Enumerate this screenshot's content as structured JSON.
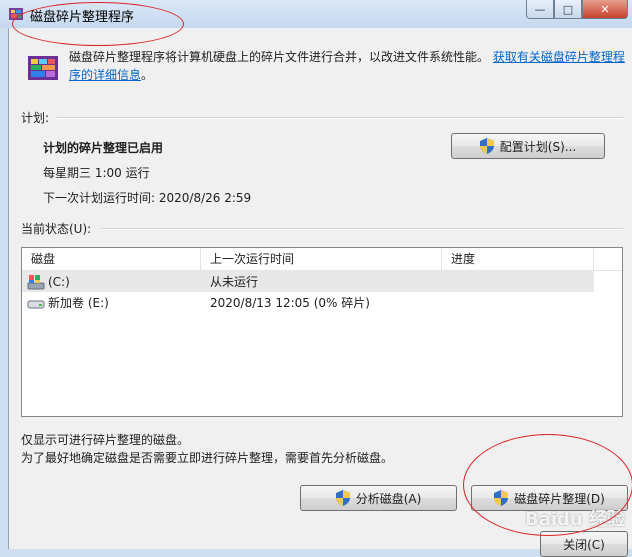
{
  "window": {
    "title": "磁盘碎片整理程序",
    "controls": {
      "minimize": "—",
      "maximize": "□",
      "close": "✕"
    }
  },
  "intro": {
    "text": "磁盘碎片整理程序将计算机硬盘上的碎片文件进行合并，以改进文件系统性能。",
    "link": "获取有关磁盘碎片整理程序的详细信息",
    "link_suffix": "。"
  },
  "schedule": {
    "label": "计划:",
    "status": "计划的碎片整理已启用",
    "frequency": "每星期三  1:00 运行",
    "next_run": "下一次计划运行时间: 2020/8/26 2:59",
    "configure_button": "配置计划(S)..."
  },
  "current_status": {
    "label": "当前状态(U):",
    "columns": [
      "磁盘",
      "上一次运行时间",
      "进度"
    ],
    "rows": [
      {
        "disk": "(C:)",
        "last_run": "从未运行",
        "progress": "",
        "icon": "system-drive-icon"
      },
      {
        "disk": "新加卷 (E:)",
        "last_run": "2020/8/13 12:05 (0% 碎片)",
        "progress": "",
        "icon": "hard-drive-icon"
      }
    ]
  },
  "notes": {
    "line1": "仅显示可进行碎片整理的磁盘。",
    "line2": "为了最好地确定磁盘是否需要立即进行碎片整理，需要首先分析磁盘。"
  },
  "buttons": {
    "analyze": "分析磁盘(A)",
    "defrag": "磁盘碎片整理(D)",
    "close": "关闭(C)"
  },
  "watermark": "Baidu 经验",
  "colors": {
    "link": "#0066cc",
    "annotation": "#dd2222"
  }
}
